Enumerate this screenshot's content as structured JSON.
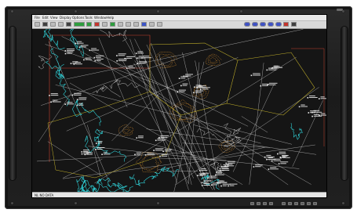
{
  "menubar": {
    "items": [
      "File",
      "Edit",
      "View",
      "Display",
      "Options",
      "Tools",
      "Window",
      "Help"
    ]
  },
  "toolbar": {
    "tools": [
      {
        "icon": "new-icon",
        "style": ""
      },
      {
        "icon": "open-icon",
        "style": "dark"
      },
      {
        "icon": "save-icon",
        "style": ""
      },
      {
        "icon": "print-icon",
        "style": ""
      },
      {
        "icon": "pointer-icon",
        "style": "dark"
      },
      {
        "icon": "layer-toggle-icon",
        "style": "wide green"
      },
      {
        "icon": "layer-toggle-icon",
        "style": "green"
      },
      {
        "icon": "filter-icon",
        "style": "red"
      },
      {
        "icon": "grid-icon",
        "style": ""
      },
      {
        "icon": "route-icon",
        "style": "green"
      },
      {
        "icon": "zoom-in-icon",
        "style": ""
      },
      {
        "icon": "zoom-out-icon",
        "style": ""
      },
      {
        "icon": "pan-icon",
        "style": ""
      },
      {
        "icon": "measure-icon",
        "style": "blue"
      },
      {
        "icon": "label-icon",
        "style": ""
      },
      {
        "icon": "track-icon",
        "style": ""
      },
      {
        "icon": "playback-icon",
        "style": "oval"
      },
      {
        "icon": "playback-icon",
        "style": "oval"
      },
      {
        "icon": "playback-icon",
        "style": "oval"
      },
      {
        "icon": "playback-icon",
        "style": "oval"
      },
      {
        "icon": "playback-icon",
        "style": "oval"
      },
      {
        "icon": "alert-icon",
        "style": "red"
      },
      {
        "icon": "close-icon",
        "style": "dark"
      }
    ]
  },
  "map": {
    "background": "#151515",
    "colors": {
      "coastline": "#2fd0d6",
      "boundary": "#e4e4e4",
      "airway": "#d8d8d8",
      "sector": "#c4b22a",
      "restricted": "#c8412e",
      "contour": "#d08a2c",
      "trackpoint": "#f0f0f0"
    }
  },
  "status": {
    "text": "NL NO DATA"
  },
  "bezel": {
    "led_count": 10
  }
}
